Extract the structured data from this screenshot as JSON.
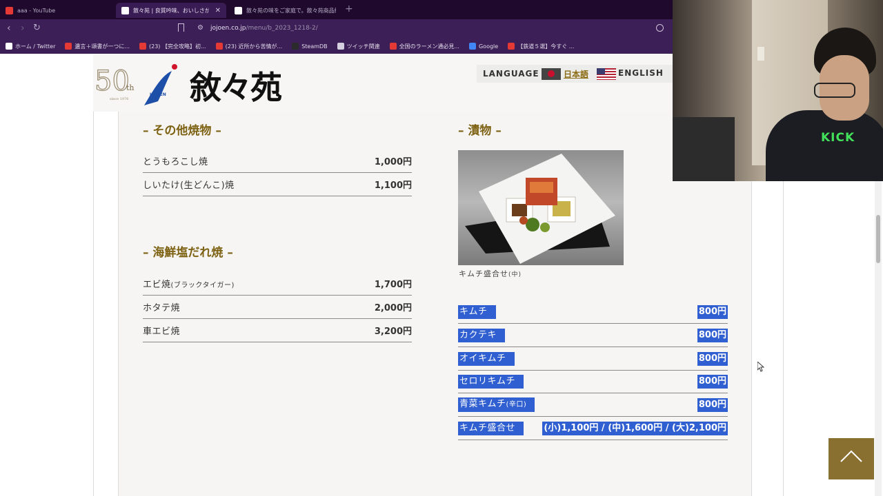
{
  "browser": {
    "tabs": [
      {
        "title": "aaa - YouTube",
        "icon": "youtube-icon",
        "active": false
      },
      {
        "title": "敘々苑 | 良質吟味、おいしさが最良",
        "icon": "jojoen-site-icon",
        "active": true,
        "close": "✕"
      },
      {
        "title": "敘々苑の味をご家庭で。敘々苑商品紹",
        "icon": "jojoen-site-icon",
        "active": false
      }
    ],
    "new_tab": "+",
    "url_host": "jojoen.co.jp",
    "url_path": "/menu/b_2023_1218-2/",
    "bookmarks": [
      {
        "label": "ホーム / Twitter",
        "icon": "x-icon",
        "color": "#ffffff"
      },
      {
        "label": "遺言＋頌書が一つに...",
        "icon": "bookmark-icon",
        "color": "#e53935"
      },
      {
        "label": "(23) 【完全攻略】初...",
        "icon": "youtube-icon",
        "color": "#e53935"
      },
      {
        "label": "(23) 近所から苦情が...",
        "icon": "youtube-icon",
        "color": "#e53935"
      },
      {
        "label": "SteamDB",
        "icon": "steamdb-icon",
        "color": "#2b2b2b"
      },
      {
        "label": "ツイッチ関連",
        "icon": "folder-icon",
        "color": "#d6cfe0"
      },
      {
        "label": "全国のラーメン通必見...",
        "icon": "ramen-icon",
        "color": "#e53935"
      },
      {
        "label": "Google",
        "icon": "google-icon",
        "color": "#4285f4"
      },
      {
        "label": "【鉄道５選】今すぐ ...",
        "icon": "youtube-icon",
        "color": "#e53935"
      }
    ]
  },
  "header": {
    "language_label": "LANGUAGE :",
    "lang_ja": "日本語",
    "lang_en": "ENGLISH",
    "brand": "敘々苑",
    "anniversary": "50",
    "anniversary_suffix": "th",
    "anniversary_since": "since 1976",
    "mark_text": "JOJOEN"
  },
  "left_column": {
    "section1": {
      "title": "– その他焼物 –",
      "items": [
        {
          "name": "とうもろこし焼",
          "price": "1,000円"
        },
        {
          "name": "しいたけ(生どんこ)焼",
          "price": "1,100円"
        }
      ]
    },
    "section2": {
      "title": "– 海鮮塩だれ焼 –",
      "items": [
        {
          "name": "エビ焼",
          "note": "(ブラックタイガー)",
          "price": "1,700円"
        },
        {
          "name": "ホタテ焼",
          "price": "2,000円"
        },
        {
          "name": "車エビ焼",
          "price": "3,200円"
        }
      ]
    }
  },
  "right_column": {
    "title": "– 漬物 –",
    "photo_caption": "キムチ盛合せ",
    "photo_caption_size": "(中)",
    "items": [
      {
        "name": "キムチ",
        "price": "800円"
      },
      {
        "name": "カクテキ",
        "price": "800円"
      },
      {
        "name": "オイキムチ",
        "price": "800円"
      },
      {
        "name": "セロリキムチ",
        "price": "800円"
      },
      {
        "name": "青菜キムチ",
        "note": "(辛口)",
        "price": "800円"
      },
      {
        "name": "キムチ盛合せ",
        "price": "(小)1,100円 / (中)1,600円 / (大)2,100円"
      }
    ],
    "selection_color": "#2f5fd0"
  },
  "colors": {
    "accent_gold": "#7d6213",
    "to_top_button": "#8a7030",
    "tab_bar": "#1f0a2e",
    "toolbar": "#3b1f56"
  },
  "webcam": {
    "shirt_text": "KICK"
  }
}
